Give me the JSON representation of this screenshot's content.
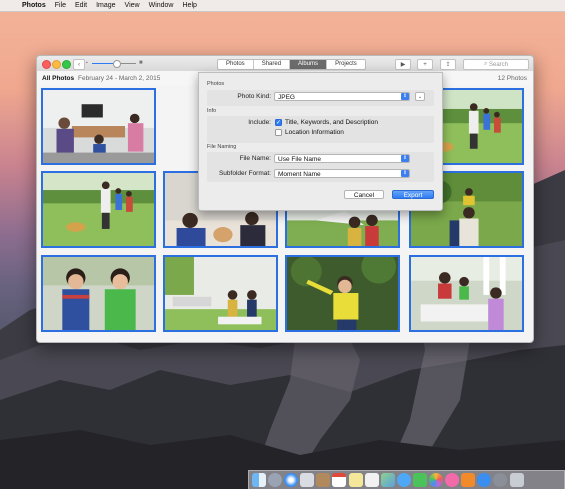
{
  "menubar": {
    "apple": "",
    "items": [
      "Photos",
      "File",
      "Edit",
      "Image",
      "View",
      "Window",
      "Help"
    ]
  },
  "toolbar": {
    "back": "‹",
    "tabs": [
      "Photos",
      "Shared",
      "Albums",
      "Projects"
    ],
    "active_tab": "Albums",
    "play": "▶",
    "add": "+",
    "share": "⇪",
    "search_placeholder": "Search",
    "zoom_level": 0.55
  },
  "subbar": {
    "title": "All Photos",
    "dates": "February 24 - March 2, 2015",
    "count": "12 Photos"
  },
  "export_sheet": {
    "photos_section": "Photos",
    "photo_kind_label": "Photo Kind:",
    "photo_kind_value": "JPEG",
    "info_section": "Info",
    "include_label": "Include:",
    "include_options": [
      {
        "label": "Title, Keywords, and Description",
        "checked": true
      },
      {
        "label": "Location Information",
        "checked": false
      }
    ],
    "file_naming_section": "File Naming",
    "file_name_label": "File Name:",
    "file_name_value": "Use File Name",
    "subfolder_label": "Subfolder Format:",
    "subfolder_value": "Moment Name",
    "cancel": "Cancel",
    "export": "Export"
  },
  "colors": {
    "accent": "#2f7bf3",
    "selection_border": "#2b6fe0",
    "active_tab": "#6b6b6b"
  },
  "dock_icons": [
    "finder-icon",
    "launchpad-icon",
    "safari-icon",
    "mail-icon",
    "contacts-icon",
    "calendar-icon",
    "notes-icon",
    "reminders-icon",
    "maps-icon",
    "messages-icon",
    "facetime-icon",
    "photos-icon",
    "itunes-icon",
    "ibooks-icon",
    "app-store-icon",
    "system-preferences-icon",
    "trash-icon"
  ]
}
